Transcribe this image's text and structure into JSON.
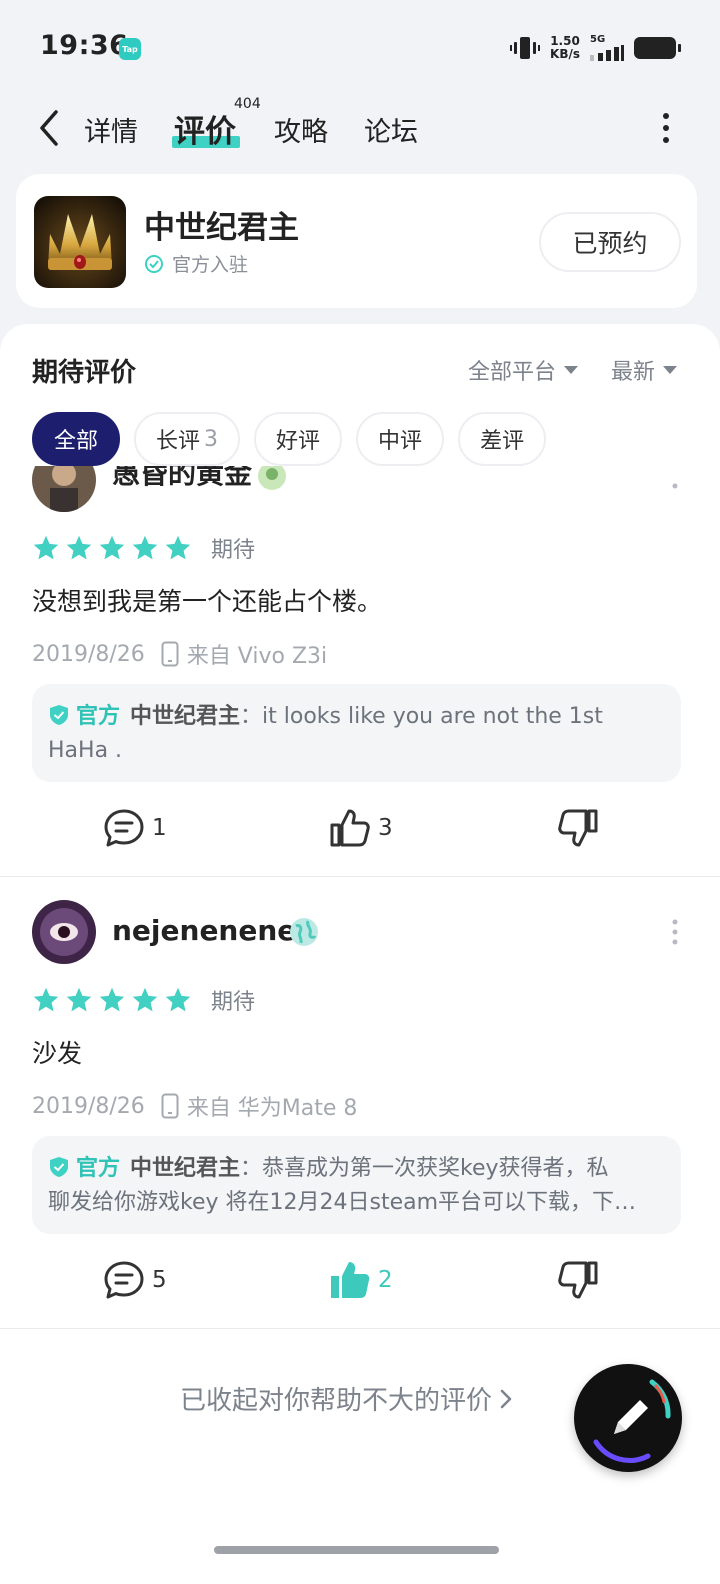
{
  "status_bar": {
    "time": "19:36",
    "app_badge": "Tap",
    "net_speed_value": "1.50",
    "net_speed_unit": "KB/s",
    "network_type": "5G"
  },
  "nav": {
    "tabs": [
      {
        "label": "详情"
      },
      {
        "label": "评价",
        "count": "404"
      },
      {
        "label": "攻略"
      },
      {
        "label": "论坛"
      }
    ]
  },
  "game": {
    "title": "中世纪君主",
    "official_label": "官方入驻",
    "reserve_label": "已预约"
  },
  "reviews_section": {
    "title": "期待评价",
    "platform_filter": "全部平台",
    "sort_filter": "最新",
    "chips": [
      {
        "label": "全部",
        "count": ""
      },
      {
        "label": "长评",
        "count": "3"
      },
      {
        "label": "好评",
        "count": ""
      },
      {
        "label": "中评",
        "count": ""
      },
      {
        "label": "差评",
        "count": ""
      }
    ]
  },
  "reviews": [
    {
      "username": "愚昏的黄金",
      "rating": 5,
      "rating_label": "期待",
      "text": "没想到我是第一个还能占个楼。",
      "date": "2019/8/26",
      "device": "来自 Vivo Z3i",
      "reply": {
        "official": "官方",
        "name": "中世纪君主",
        "line1": "：it looks like you are not the 1st",
        "line2": "HaHa ."
      },
      "comments": "1",
      "likes": "3",
      "liked": false
    },
    {
      "username": "nejenenenen",
      "rating": 5,
      "rating_label": "期待",
      "text": "沙发",
      "date": "2019/8/26",
      "device": "来自 华为Mate 8",
      "reply": {
        "official": "官方",
        "name": "中世纪君主",
        "line1": "：恭喜成为第一次获奖key获得者，私",
        "line2": "聊发给你游戏key 将在12月24日steam平台可以下载，下…"
      },
      "comments": "5",
      "likes": "2",
      "liked": true
    }
  ],
  "collapsed_link": "已收起对你帮助不大的评价",
  "colors": {
    "accent": "#3ed1c4",
    "chip_active": "#1d1f6e",
    "liked": "#3ec9bd"
  }
}
